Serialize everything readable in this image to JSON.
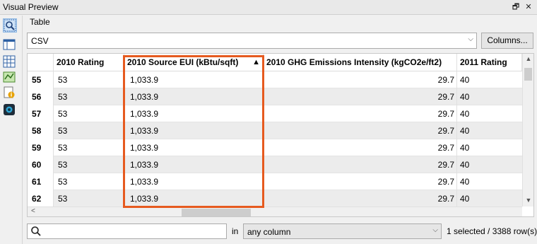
{
  "window": {
    "title": "Visual Preview"
  },
  "toolbar": {
    "restore_glyph": "🗗",
    "close_glyph": "✕"
  },
  "tabs": {
    "table_label": "Table"
  },
  "source_select": {
    "value": "CSV"
  },
  "columns_button": {
    "label": "Columns..."
  },
  "table": {
    "columns": [
      "2010 Rating",
      "2010 Source EUI (kBtu/sqft)",
      "2010 GHG Emissions Intensity (kgCO2e/ft2)",
      "2011 Rating"
    ],
    "sorted_column": "2010 Source EUI (kBtu/sqft)",
    "sort_glyph": "▲",
    "rows": [
      {
        "id": "55",
        "c1": "53",
        "c2": "1,033.9",
        "c3": "29.7",
        "c4": "40"
      },
      {
        "id": "56",
        "c1": "53",
        "c2": "1,033.9",
        "c3": "29.7",
        "c4": "40"
      },
      {
        "id": "57",
        "c1": "53",
        "c2": "1,033.9",
        "c3": "29.7",
        "c4": "40"
      },
      {
        "id": "58",
        "c1": "53",
        "c2": "1,033.9",
        "c3": "29.7",
        "c4": "40"
      },
      {
        "id": "59",
        "c1": "53",
        "c2": "1,033.9",
        "c3": "29.7",
        "c4": "40"
      },
      {
        "id": "60",
        "c1": "53",
        "c2": "1,033.9",
        "c3": "29.7",
        "c4": "40"
      },
      {
        "id": "61",
        "c1": "53",
        "c2": "1,033.9",
        "c3": "29.7",
        "c4": "40"
      },
      {
        "id": "62",
        "c1": "53",
        "c2": "1,033.9",
        "c3": "29.7",
        "c4": "40"
      }
    ]
  },
  "search": {
    "value": "",
    "placeholder": ""
  },
  "filter": {
    "in_label": "in",
    "column_select": "any column"
  },
  "status": {
    "text": "1 selected / 3388 row(s)"
  },
  "colors": {
    "highlight": "#e65a1f",
    "selection": "#cfe3f7",
    "alt_row": "#ececec"
  },
  "icons": [
    "search-icon",
    "table-view-icon",
    "grid-icon",
    "map-icon",
    "info-icon",
    "camera-icon"
  ]
}
